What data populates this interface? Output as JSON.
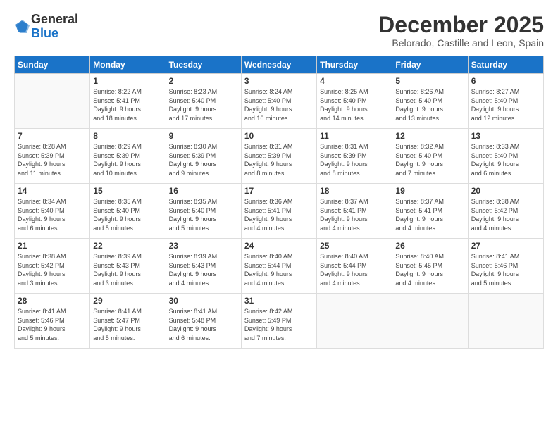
{
  "logo": {
    "general": "General",
    "blue": "Blue"
  },
  "title": "December 2025",
  "location": "Belorado, Castille and Leon, Spain",
  "days_header": [
    "Sunday",
    "Monday",
    "Tuesday",
    "Wednesday",
    "Thursday",
    "Friday",
    "Saturday"
  ],
  "weeks": [
    [
      {
        "day": "",
        "info": ""
      },
      {
        "day": "1",
        "info": "Sunrise: 8:22 AM\nSunset: 5:41 PM\nDaylight: 9 hours\nand 18 minutes."
      },
      {
        "day": "2",
        "info": "Sunrise: 8:23 AM\nSunset: 5:40 PM\nDaylight: 9 hours\nand 17 minutes."
      },
      {
        "day": "3",
        "info": "Sunrise: 8:24 AM\nSunset: 5:40 PM\nDaylight: 9 hours\nand 16 minutes."
      },
      {
        "day": "4",
        "info": "Sunrise: 8:25 AM\nSunset: 5:40 PM\nDaylight: 9 hours\nand 14 minutes."
      },
      {
        "day": "5",
        "info": "Sunrise: 8:26 AM\nSunset: 5:40 PM\nDaylight: 9 hours\nand 13 minutes."
      },
      {
        "day": "6",
        "info": "Sunrise: 8:27 AM\nSunset: 5:40 PM\nDaylight: 9 hours\nand 12 minutes."
      }
    ],
    [
      {
        "day": "7",
        "info": "Sunrise: 8:28 AM\nSunset: 5:39 PM\nDaylight: 9 hours\nand 11 minutes."
      },
      {
        "day": "8",
        "info": "Sunrise: 8:29 AM\nSunset: 5:39 PM\nDaylight: 9 hours\nand 10 minutes."
      },
      {
        "day": "9",
        "info": "Sunrise: 8:30 AM\nSunset: 5:39 PM\nDaylight: 9 hours\nand 9 minutes."
      },
      {
        "day": "10",
        "info": "Sunrise: 8:31 AM\nSunset: 5:39 PM\nDaylight: 9 hours\nand 8 minutes."
      },
      {
        "day": "11",
        "info": "Sunrise: 8:31 AM\nSunset: 5:39 PM\nDaylight: 9 hours\nand 8 minutes."
      },
      {
        "day": "12",
        "info": "Sunrise: 8:32 AM\nSunset: 5:40 PM\nDaylight: 9 hours\nand 7 minutes."
      },
      {
        "day": "13",
        "info": "Sunrise: 8:33 AM\nSunset: 5:40 PM\nDaylight: 9 hours\nand 6 minutes."
      }
    ],
    [
      {
        "day": "14",
        "info": "Sunrise: 8:34 AM\nSunset: 5:40 PM\nDaylight: 9 hours\nand 6 minutes."
      },
      {
        "day": "15",
        "info": "Sunrise: 8:35 AM\nSunset: 5:40 PM\nDaylight: 9 hours\nand 5 minutes."
      },
      {
        "day": "16",
        "info": "Sunrise: 8:35 AM\nSunset: 5:40 PM\nDaylight: 9 hours\nand 5 minutes."
      },
      {
        "day": "17",
        "info": "Sunrise: 8:36 AM\nSunset: 5:41 PM\nDaylight: 9 hours\nand 4 minutes."
      },
      {
        "day": "18",
        "info": "Sunrise: 8:37 AM\nSunset: 5:41 PM\nDaylight: 9 hours\nand 4 minutes."
      },
      {
        "day": "19",
        "info": "Sunrise: 8:37 AM\nSunset: 5:41 PM\nDaylight: 9 hours\nand 4 minutes."
      },
      {
        "day": "20",
        "info": "Sunrise: 8:38 AM\nSunset: 5:42 PM\nDaylight: 9 hours\nand 4 minutes."
      }
    ],
    [
      {
        "day": "21",
        "info": "Sunrise: 8:38 AM\nSunset: 5:42 PM\nDaylight: 9 hours\nand 3 minutes."
      },
      {
        "day": "22",
        "info": "Sunrise: 8:39 AM\nSunset: 5:43 PM\nDaylight: 9 hours\nand 3 minutes."
      },
      {
        "day": "23",
        "info": "Sunrise: 8:39 AM\nSunset: 5:43 PM\nDaylight: 9 hours\nand 4 minutes."
      },
      {
        "day": "24",
        "info": "Sunrise: 8:40 AM\nSunset: 5:44 PM\nDaylight: 9 hours\nand 4 minutes."
      },
      {
        "day": "25",
        "info": "Sunrise: 8:40 AM\nSunset: 5:44 PM\nDaylight: 9 hours\nand 4 minutes."
      },
      {
        "day": "26",
        "info": "Sunrise: 8:40 AM\nSunset: 5:45 PM\nDaylight: 9 hours\nand 4 minutes."
      },
      {
        "day": "27",
        "info": "Sunrise: 8:41 AM\nSunset: 5:46 PM\nDaylight: 9 hours\nand 5 minutes."
      }
    ],
    [
      {
        "day": "28",
        "info": "Sunrise: 8:41 AM\nSunset: 5:46 PM\nDaylight: 9 hours\nand 5 minutes."
      },
      {
        "day": "29",
        "info": "Sunrise: 8:41 AM\nSunset: 5:47 PM\nDaylight: 9 hours\nand 5 minutes."
      },
      {
        "day": "30",
        "info": "Sunrise: 8:41 AM\nSunset: 5:48 PM\nDaylight: 9 hours\nand 6 minutes."
      },
      {
        "day": "31",
        "info": "Sunrise: 8:42 AM\nSunset: 5:49 PM\nDaylight: 9 hours\nand 7 minutes."
      },
      {
        "day": "",
        "info": ""
      },
      {
        "day": "",
        "info": ""
      },
      {
        "day": "",
        "info": ""
      }
    ]
  ]
}
